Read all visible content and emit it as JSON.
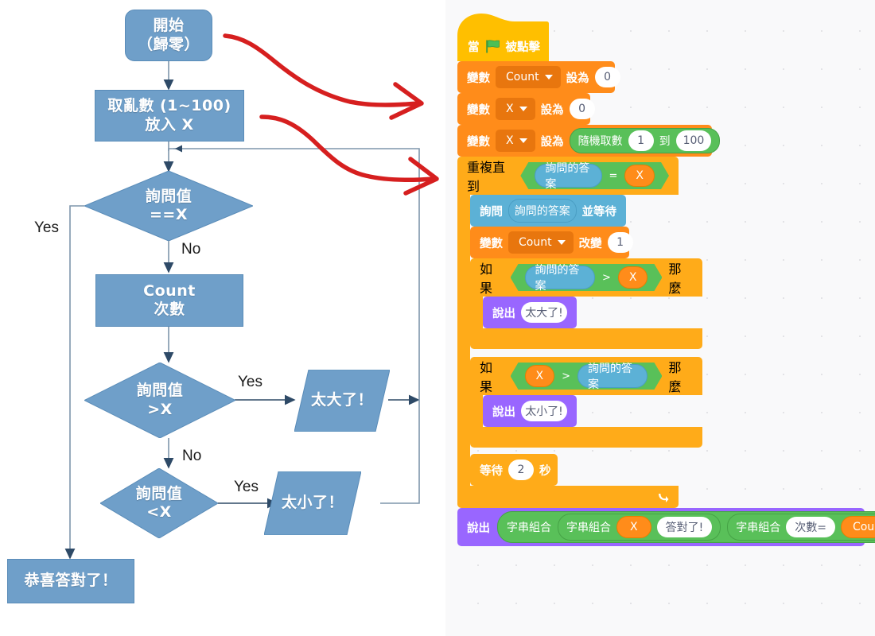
{
  "flowchart": {
    "nodes": [
      {
        "id": "start",
        "shape": "rounded-rect",
        "text": "開始\n（歸零）"
      },
      {
        "id": "random",
        "shape": "rect",
        "text": "取亂數 (1~100)\n放入 X"
      },
      {
        "id": "check-equal",
        "shape": "diamond",
        "text": "詢問值\n==X"
      },
      {
        "id": "count",
        "shape": "rect",
        "text": "Count\n次數"
      },
      {
        "id": "check-greater",
        "shape": "diamond",
        "text": "詢問值\n>X"
      },
      {
        "id": "too-big",
        "shape": "parallelogram",
        "text": "太大了！"
      },
      {
        "id": "check-less",
        "shape": "diamond",
        "text": "詢問值\n<X"
      },
      {
        "id": "too-small",
        "shape": "parallelogram",
        "text": "太小了！"
      },
      {
        "id": "congrats",
        "shape": "rect",
        "text": "恭喜答對了！"
      }
    ],
    "edge_labels": [
      {
        "id": "yes-equal",
        "text": "Yes"
      },
      {
        "id": "no-equal",
        "text": "No"
      },
      {
        "id": "yes-greater",
        "text": "Yes"
      },
      {
        "id": "no-greater",
        "text": "No"
      },
      {
        "id": "yes-less",
        "text": "Yes"
      }
    ],
    "colors": {
      "shape_fill": "#6f9fc9",
      "shape_stroke": "#5a8cb8",
      "connector": "#7f96ac",
      "arrow_dark": "#2e4a67",
      "annotation": "#d61f1f"
    }
  },
  "scratch": {
    "hat": {
      "when": "當",
      "clicked": "被點擊",
      "icon": "green-flag-icon"
    },
    "blocks": [
      {
        "id": "set-count-0",
        "label_var": "變數",
        "variable": "Count",
        "label_set": "設為",
        "value": "0"
      },
      {
        "id": "set-x-0",
        "label_var": "變數",
        "variable": "X",
        "label_set": "設為",
        "value": "0"
      },
      {
        "id": "set-x-random",
        "label_var": "變數",
        "variable": "X",
        "label_set": "設為",
        "op": "隨機取數",
        "from": "1",
        "label_to": "到",
        "to": "100"
      },
      {
        "id": "repeat-until",
        "label": "重複直到",
        "cond_left": "詢問的答案",
        "cond_op": "=",
        "cond_right": "X"
      },
      {
        "id": "ask",
        "label_ask": "詢問",
        "prompt": "詢問的答案",
        "label_wait": "並等待"
      },
      {
        "id": "change-count",
        "label_var": "變數",
        "variable": "Count",
        "label_change": "改變",
        "value": "1"
      },
      {
        "id": "if-greater",
        "label_if": "如果",
        "cond_left": "詢問的答案",
        "cond_op": ">",
        "cond_right": "X",
        "label_then": "那麼"
      },
      {
        "id": "say-too-big",
        "label_say": "說出",
        "value": "太大了!"
      },
      {
        "id": "if-less",
        "label_if": "如果",
        "cond_left": "X",
        "cond_op": ">",
        "cond_right": "詢問的答案",
        "label_then": "那麼"
      },
      {
        "id": "say-too-small",
        "label_say": "說出",
        "value": "太小了!"
      },
      {
        "id": "wait",
        "label_wait": "等待",
        "value": "2",
        "label_sec": "秒"
      },
      {
        "id": "say-final",
        "label_say": "說出",
        "join1": "字串組合",
        "join2": "字串組合",
        "var_x": "X",
        "text_correct": "答對了!",
        "join3": "字串組合",
        "text_count": "次數=",
        "var_count": "Count"
      }
    ],
    "colors": {
      "events": "#ffbf00",
      "variables": "#ff8c1a",
      "variables_dark": "#e8760e",
      "control": "#ffab19",
      "sensing": "#5cb1d6",
      "looks": "#9966ff",
      "operators": "#59c059",
      "canvas": "#f9f9fa",
      "dot": "#e3e3e6"
    }
  }
}
